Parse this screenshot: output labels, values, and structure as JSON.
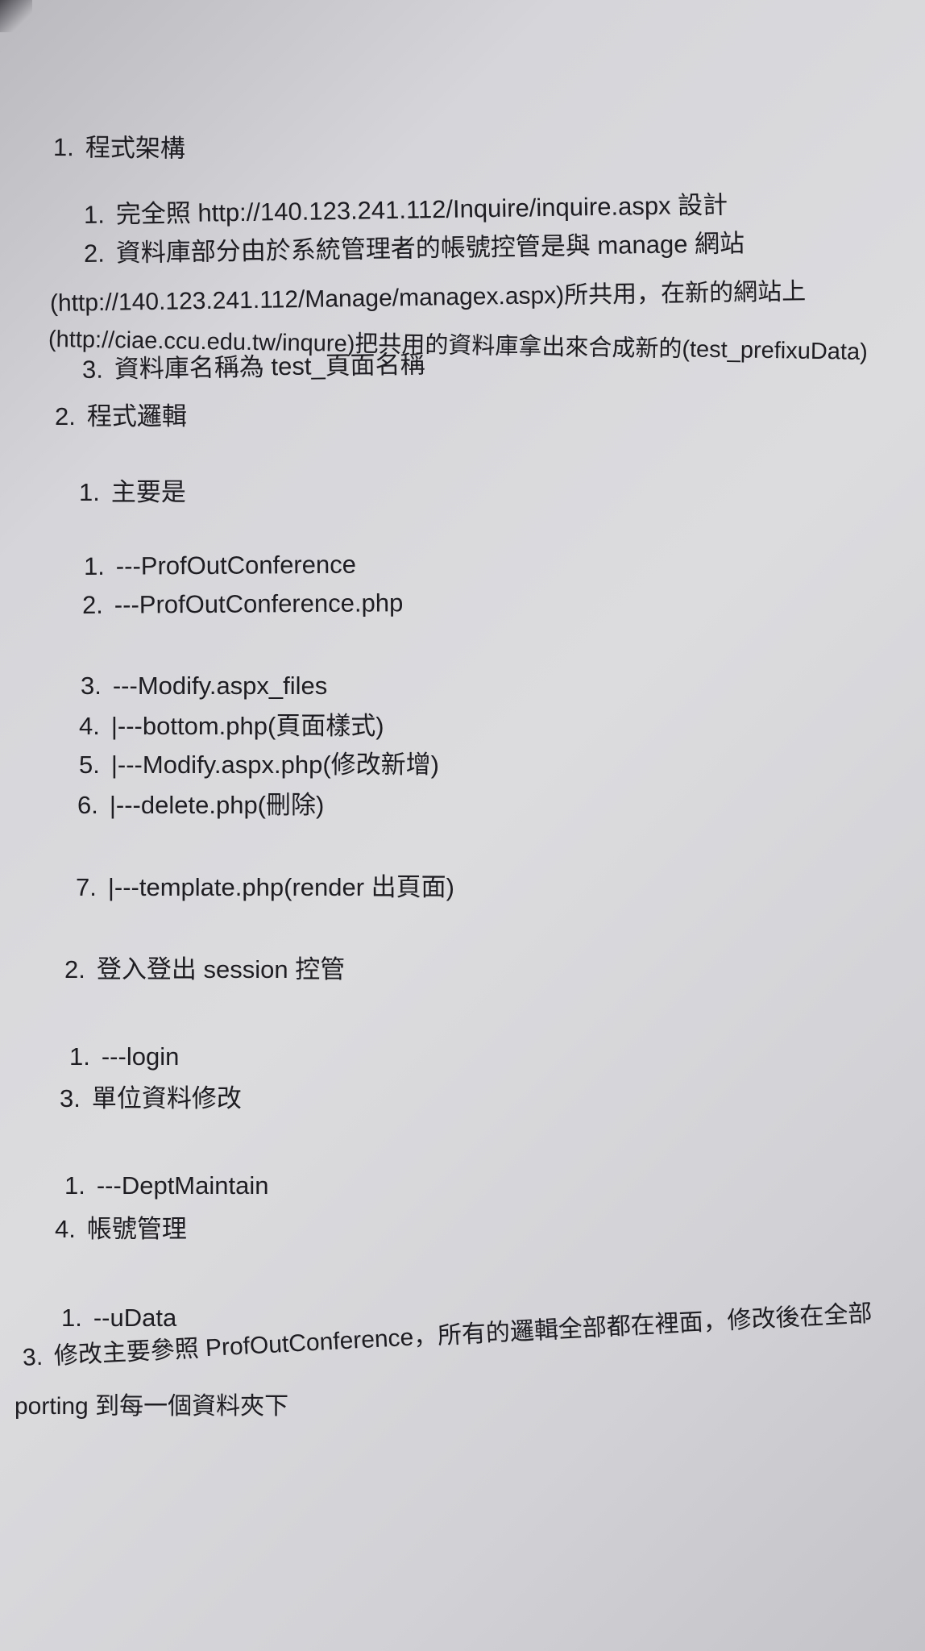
{
  "document": {
    "lines": [
      {
        "num": "1.",
        "text": "程式架構"
      },
      {
        "num": "1.",
        "text": "完全照 http://140.123.241.112/Inquire/inquire.aspx 設計"
      },
      {
        "num": "2.",
        "text": "資料庫部分由於系統管理者的帳號控管是與 manage 網站"
      },
      {
        "num": "",
        "text": "(http://140.123.241.112/Manage/managex.aspx)所共用，在新的網站上"
      },
      {
        "num": "",
        "text": "(http://ciae.ccu.edu.tw/inqure)把共用的資料庫拿出來合成新的(test_prefixuData)"
      },
      {
        "num": "3.",
        "text": "資料庫名稱為 test_頁面名稱"
      },
      {
        "num": "2.",
        "text": "程式邏輯"
      },
      {
        "num": "1.",
        "text": "主要是"
      },
      {
        "num": "1.",
        "text": "---ProfOutConference"
      },
      {
        "num": "2.",
        "text": "---ProfOutConference.php"
      },
      {
        "num": "3.",
        "text": "---Modify.aspx_files"
      },
      {
        "num": "4.",
        "text": "|---bottom.php(頁面樣式)"
      },
      {
        "num": "5.",
        "text": "|---Modify.aspx.php(修改新增)"
      },
      {
        "num": "6.",
        "text": "|---delete.php(刪除)"
      },
      {
        "num": "7.",
        "text": "|---template.php(render 出頁面)"
      },
      {
        "num": "2.",
        "text": "登入登出 session 控管"
      },
      {
        "num": "1.",
        "text": "---login"
      },
      {
        "num": "3.",
        "text": "單位資料修改"
      },
      {
        "num": "1.",
        "text": "---DeptMaintain"
      },
      {
        "num": "4.",
        "text": "帳號管理"
      },
      {
        "num": "1.",
        "text": "--uData"
      },
      {
        "num": "3.",
        "text": "修改主要參照 ProfOutConference，所有的邏輯全部都在裡面，修改後在全部"
      },
      {
        "num": "",
        "text": "porting 到每一個資料夾下"
      }
    ]
  }
}
